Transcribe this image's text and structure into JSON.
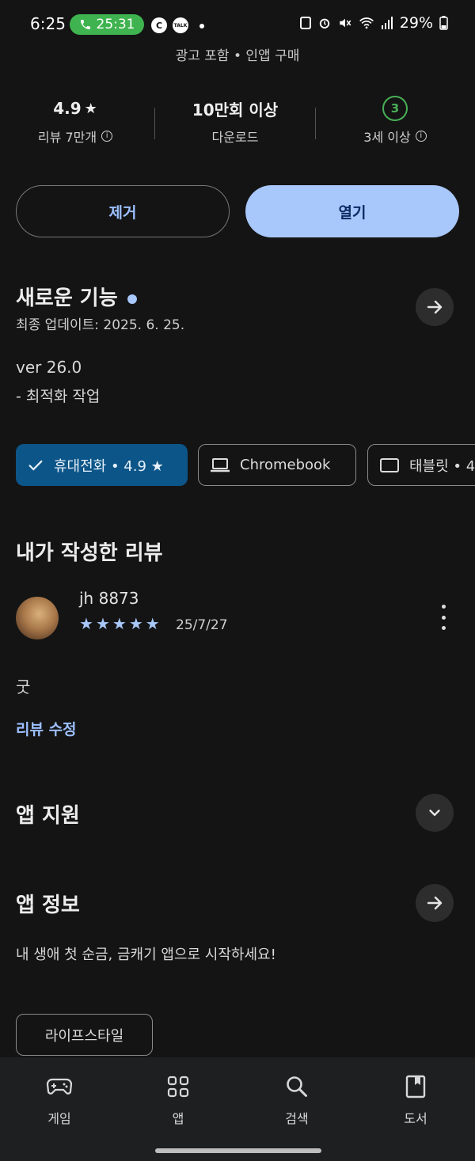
{
  "status_bar": {
    "time": "6:25",
    "call_timer": "25:31",
    "app_icon_c": "C",
    "app_icon_talk": "TALK",
    "battery": "29%",
    "icons": [
      "call-icon",
      "c-app-icon",
      "kakaotalk-icon",
      "notification-dot",
      "clip-icon",
      "alarm-icon",
      "mute-icon",
      "wifi-icon",
      "signal-icon",
      "battery-icon"
    ]
  },
  "app_meta": {
    "ads_and_purchases": "광고 포함 • 인앱 구매"
  },
  "stats": {
    "rating": "4.9",
    "rating_star": "★",
    "reviews_label": "리뷰 7만개",
    "downloads": "10만회 이상",
    "downloads_label": "다운로드",
    "age_badge": "3",
    "age_label": "3세 이상"
  },
  "actions": {
    "uninstall_label": "제거",
    "open_label": "열기"
  },
  "whats_new": {
    "title": "새로운 기능",
    "updated": "최종 업데이트: 2025. 6. 25.",
    "version": "ver 26.0",
    "note": "- 최적화 작업"
  },
  "device_chips": [
    {
      "label": "휴대전화 • 4.9 ★",
      "selected": true,
      "icon": "check-icon"
    },
    {
      "label": "Chromebook",
      "selected": false,
      "icon": "laptop-icon"
    },
    {
      "label": "태블릿 • 4",
      "selected": false,
      "icon": "tablet-icon"
    }
  ],
  "my_review": {
    "section_title": "내가 작성한 리뷰",
    "author": "jh 8873",
    "stars": 5,
    "date": "25/7/27",
    "text": "굿",
    "edit_label": "리뷰 수정"
  },
  "app_support": {
    "title": "앱 지원"
  },
  "app_info": {
    "title": "앱 정보",
    "description": "내 생애 첫 순금, 금캐기 앱으로 시작하세요!",
    "category_tag": "라이프스타일"
  },
  "bottom_nav": {
    "items": [
      {
        "label": "게임",
        "icon": "gamepad-icon"
      },
      {
        "label": "앱",
        "icon": "apps-grid-icon"
      },
      {
        "label": "검색",
        "icon": "search-icon"
      },
      {
        "label": "도서",
        "icon": "book-icon"
      }
    ]
  },
  "colors": {
    "background": "#141414",
    "accent": "#a8c7fa",
    "selected_chip": "#0c5588",
    "call_green": "#3fb34f",
    "age_green": "#49b057"
  }
}
